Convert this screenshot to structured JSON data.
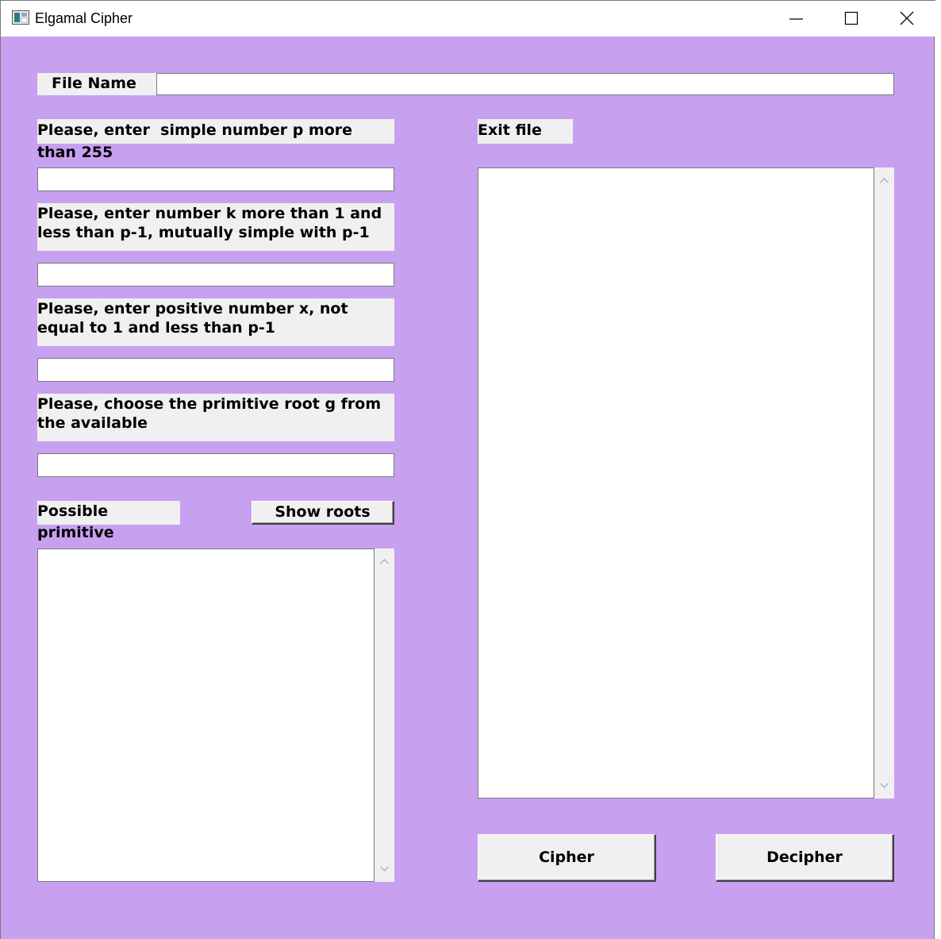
{
  "window": {
    "title": "Elgamal Cipher",
    "background": "#c8a0f0"
  },
  "file_name": {
    "label": "File Name",
    "value": ""
  },
  "prompts": {
    "p": "Please, enter  simple number p more than 255",
    "k": "Please, enter number k more than 1 and less than p-1, mutually simple with p-1",
    "x": "Please, enter positive number x, not equal to 1 and less than p-1",
    "g": "Please, choose the primitive root g from the available"
  },
  "inputs": {
    "p": "",
    "k": "",
    "x": "",
    "g": ""
  },
  "roots": {
    "label": "Possible primitive",
    "show_button": "Show roots",
    "content": ""
  },
  "exit_file": {
    "label": "Exit file",
    "content": ""
  },
  "actions": {
    "cipher": "Cipher",
    "decipher": "Decipher"
  },
  "icons": [
    "app-icon",
    "minimize-icon",
    "maximize-icon",
    "close-icon",
    "scroll-up-icon",
    "scroll-down-icon"
  ]
}
